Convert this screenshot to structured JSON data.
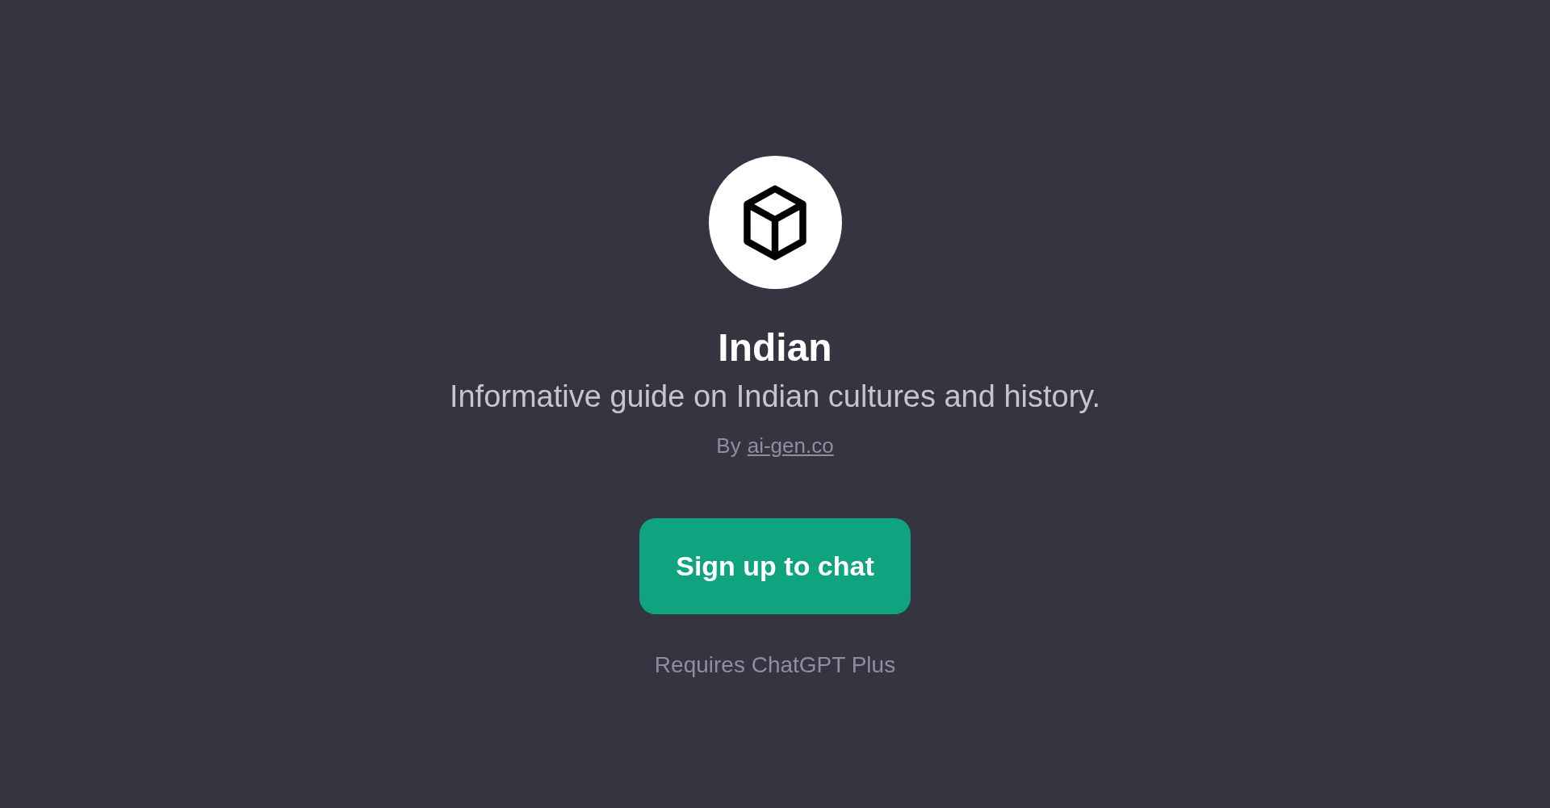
{
  "title": "Indian",
  "description": "Informative guide on Indian cultures and history.",
  "author": {
    "prefix": "By",
    "link": "ai-gen.co"
  },
  "button": "Sign up to chat",
  "note": "Requires ChatGPT Plus"
}
